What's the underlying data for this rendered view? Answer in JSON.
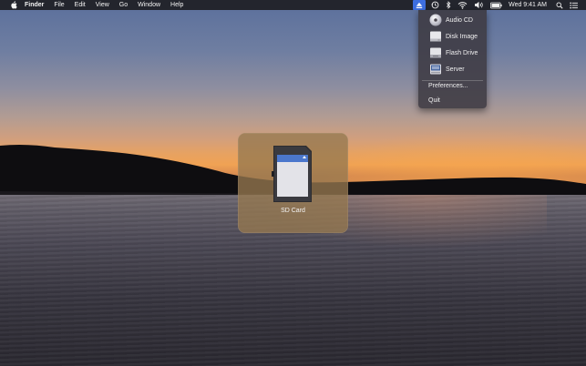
{
  "menubar": {
    "app_name": "Finder",
    "menus": [
      "File",
      "Edit",
      "View",
      "Go",
      "Window",
      "Help"
    ],
    "clock": "Wed 9:41 AM",
    "status_icons": [
      "eject-icon",
      "time-machine-icon",
      "bluetooth-icon",
      "wifi-icon",
      "volume-icon",
      "battery-icon",
      "spotlight-search-icon",
      "notification-center-icon"
    ]
  },
  "dropdown": {
    "items": [
      {
        "label": "Audio CD",
        "icon": "audio-cd-icon"
      },
      {
        "label": "Disk Image",
        "icon": "disk-image-icon"
      },
      {
        "label": "Flash Drive",
        "icon": "flash-drive-icon"
      },
      {
        "label": "Server",
        "icon": "server-icon"
      }
    ],
    "preferences_label": "Preferences...",
    "quit_label": "Quit"
  },
  "hud": {
    "label": "SD Card",
    "icon": "sd-card-icon"
  },
  "colors": {
    "accent": "#3d6ee0",
    "menubar_bg": "#1e1e24"
  }
}
